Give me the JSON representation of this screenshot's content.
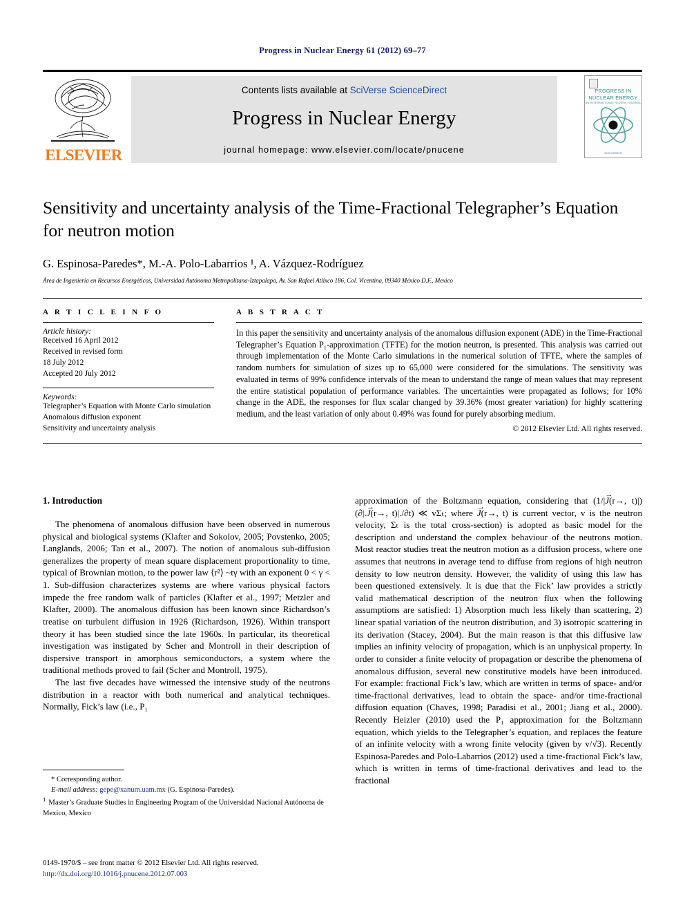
{
  "running_head": "Progress in Nuclear Energy 61 (2012) 69–77",
  "banner": {
    "publisher_name": "ELSEVIER",
    "publisher_logo_icon": "elsevier-tree-icon",
    "contents_prefix": "Contents lists available at ",
    "contents_link": "SciVerse ScienceDirect",
    "journal_name": "Progress in Nuclear Energy",
    "homepage": "journal homepage: www.elsevier.com/locate/pnucene",
    "cover": {
      "title_line1": "PROGRESS IN",
      "title_line2": "NUCLEAR ENERGY",
      "subtitle": "AN INTERNATIONAL REVIEW JOURNAL",
      "footer": "ScienceDirect",
      "atom_icon": "atom-icon"
    }
  },
  "title": "Sensitivity and uncertainty analysis of the Time-Fractional Telegrapher’s Equation for neutron motion",
  "authors": "G. Espinosa-Paredes*, M.-A. Polo-Labarrios ¹, A. Vázquez-Rodríguez",
  "affiliation": "Área de Ingeniería en Recursos Energéticos, Universidad Autónoma Metropolitana-Iztapalapa, Av. San Rafael Atlixco 186, Col. Vicentina, 09340 México D.F., Mexico",
  "article_info": {
    "heading": "A R T I C L E  I N F O",
    "history_label": "Article history:",
    "history": [
      "Received 16 April 2012",
      "Received in revised form",
      "18 July 2012",
      "Accepted 20 July 2012"
    ],
    "keywords_label": "Keywords:",
    "keywords": [
      "Telegrapher’s Equation with Monte Carlo simulation",
      "Anomalous diffusion exponent",
      "Sensitivity and uncertainty analysis"
    ]
  },
  "abstract": {
    "heading": "A B S T R A C T",
    "text": "In this paper the sensitivity and uncertainty analysis of the anomalous diffusion exponent (ADE) in the Time-Fractional Telegrapher’s Equation P₁-approximation (TFTE) for the motion neutron, is presented. This analysis was carried out through implementation of the Monte Carlo simulations in the numerical solution of TFTE, where the samples of random numbers for simulation of sizes up to 65,000 were considered for the simulations. The sensitivity was evaluated in terms of 99% confidence intervals of the mean to understand the range of mean values that may represent the entire statistical population of performance variables. The uncertainties were propagated as follows; for 10% change in the ADE, the responses for flux scalar changed by 39.36% (most greater variation) for highly scattering medium, and the least variation of only about 0.49% was found for purely absorbing medium.",
    "copyright": "© 2012 Elsevier Ltd. All rights reserved."
  },
  "body": {
    "section_number_title": "1. Introduction",
    "left_p1": "The phenomena of anomalous diffusion have been observed in numerous physical and biological systems (Klafter and Sokolov, 2005; Povstenko, 2005; Langlands, 2006; Tan et al., 2007). The notion of anomalous sub-diffusion generalizes the property of mean square displacement proportionality to time, typical of Brownian motion, to the power law ⟨r²⟩ ~tγ with an exponent 0 < γ < 1. Sub-diffusion characterizes systems are where various physical factors impede the free random walk of particles (Klafter et al., 1997; Metzler and Klafter, 2000). The anomalous diffusion has been known since Richardson’s treatise on turbulent diffusion in 1926 (Richardson, 1926). Within transport theory it has been studied since the late 1960s. In particular, its theoretical investigation was instigated by Scher and Montroll in their description of dispersive transport in amorphous semiconductors, a system where the traditional methods proved to fail (Scher and Montroll, 1975).",
    "left_p2": "The last five decades have witnessed the intensive study of the neutrons distribution in a reactor with both numerical and analytical techniques. Normally, Fick’s law (i.e., P₁",
    "right_p1_a": "approximation of the Boltzmann equation, considering that (1/|",
    "right_p1_b": "(r→, t)|)(∂|.",
    "right_p1_c": "(r→, t)|./∂t) ≪ vΣₜ; where ",
    "right_p1_d": "(r→, t) is current vector, v is the neutron velocity, Σₜ is the total cross-section) is adopted as basic model for the description and understand the complex behaviour of the neutrons motion. Most reactor studies treat the neutron motion as a diffusion process, where one assumes that neutrons in average tend to diffuse from regions of high neutron density to low neutron density. However, the validity of using this law has been questioned extensively. It is due that the Fick’ law provides a strictly valid mathematical description of the neutron flux when the following assumptions are satisfied: 1) Absorption much less likely than scattering, 2) linear spatial variation of the neutron distribution, and 3) isotropic scattering in its derivation (Stacey, 2004). But the main reason is that this diffusive law implies an infinity velocity of propagation, which is an unphysical property. In order to consider a finite velocity of propagation or describe the phenomena of anomalous diffusion, several new constitutive models have been introduced. For example: fractional Fick’s law, which are written in terms of space- and/or time-fractional derivatives, lead to obtain the space- and/or time-fractional diffusion equation (Chaves, 1998; Paradisi et al., 2001; Jiang et al., 2000). Recently Heizler (2010) used the P₁ approximation for the Boltzmann equation, which yields to the Telegrapher’s equation, and replaces the feature of an infinite velocity with a wrong finite velocity (given by v/√3). Recently Espinosa-Paredes and Polo-Labarrios (2012) used a time-fractional Fick’s law, which is written in terms of time-fractional derivatives and lead to the fractional"
  },
  "footnotes": {
    "corresponding": "* Corresponding author.",
    "email_label": "E-mail address:",
    "email": "gepe@xanum.uam.mx",
    "email_owner": "(G. Espinosa-Paredes).",
    "note1_mark": "1",
    "note1": "Master’s Graduate Studies in Engineering Program of the Universidad Nacional Autónoma de Mexico, Mexico"
  },
  "page_footer": {
    "issn_line": "0149-1970/$ – see front matter © 2012 Elsevier Ltd. All rights reserved.",
    "doi": "http://dx.doi.org/10.1016/j.pnucene.2012.07.003"
  },
  "colors": {
    "link_blue": "#1b2f8a",
    "sciencedirect_blue": "#1a4fa0",
    "elsevier_orange": "#f07c1f",
    "banner_gray": "#e3e3e3",
    "cover_teal": "#2f8c8c"
  }
}
